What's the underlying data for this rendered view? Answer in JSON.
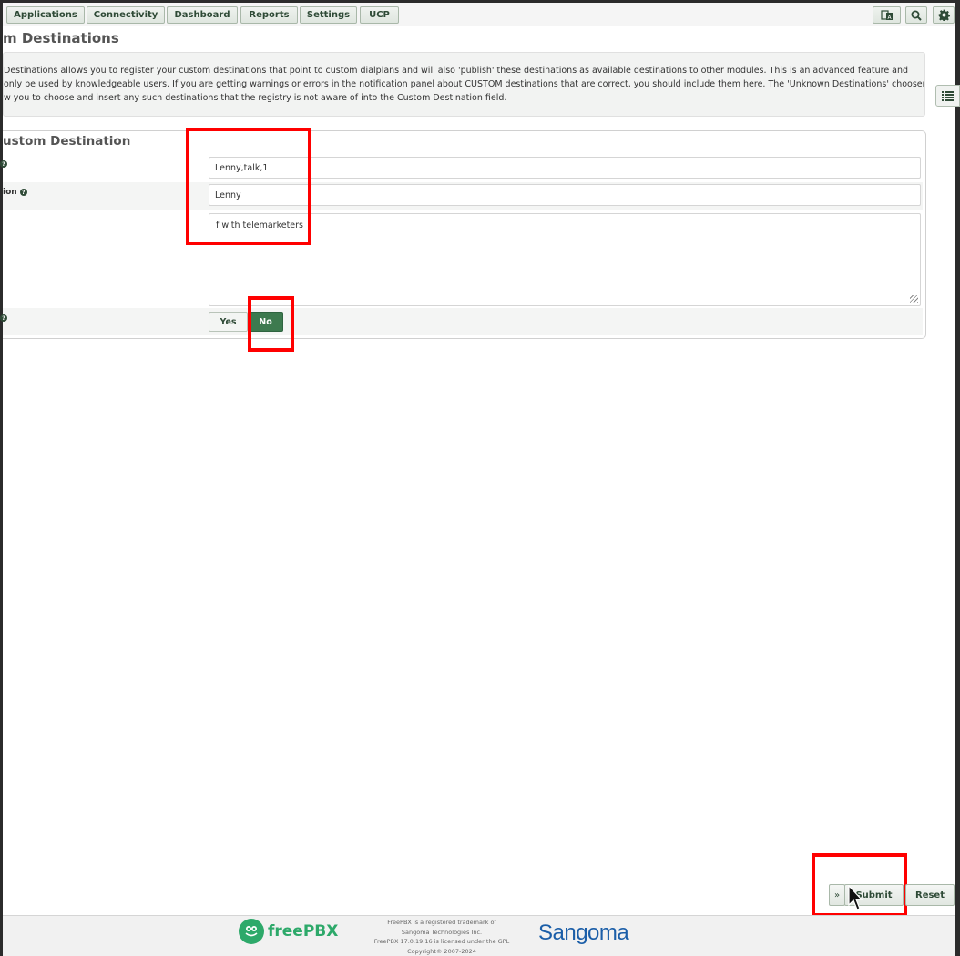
{
  "nav": {
    "items": [
      {
        "label": "Applications"
      },
      {
        "label": "Connectivity"
      },
      {
        "label": "Dashboard"
      },
      {
        "label": "Reports"
      },
      {
        "label": "Settings"
      },
      {
        "label": "UCP"
      }
    ],
    "icons": [
      "language-icon",
      "search-icon",
      "gear-icon"
    ]
  },
  "page": {
    "title": "m Destinations",
    "description_lines": [
      "Destinations allows you to register your custom destinations that point to custom dialplans and will also 'publish' these destinations as available destinations to other modules. This is an advanced feature and",
      "only be used by knowledgeable users. If you are getting warnings or errors in the notification panel about CUSTOM destinations that are correct, you should include them here. The 'Unknown Destinations' chooser",
      "w you to choose and insert any such destinations that the registry is not aware of into the Custom Destination field."
    ]
  },
  "form": {
    "title": "ustom Destination",
    "target_value": "Lenny,talk,1",
    "description_label": "ion",
    "description_value": "Lenny",
    "notes_value": "f with telemarketers",
    "return_yes": "Yes",
    "return_no": "No",
    "return_selected": "No"
  },
  "actions": {
    "expand": "»",
    "submit": "Submit",
    "reset": "Reset"
  },
  "footer": {
    "freepbx_logo_text": "freePBX",
    "legal_lines": [
      "FreePBX is a registered trademark of",
      "Sangoma Technologies Inc.",
      "FreePBX 17.0.19.16 is licensed under the GPL",
      "Copyright© 2007-2024"
    ],
    "sangoma_logo_text": "Sangoma"
  },
  "colors": {
    "accent_green": "#3d7a4f",
    "nav_text": "#2e4a36",
    "highlight": "#ff0000",
    "sangoma_blue": "#1b5ea8",
    "freepbx_green": "#2da96a"
  }
}
